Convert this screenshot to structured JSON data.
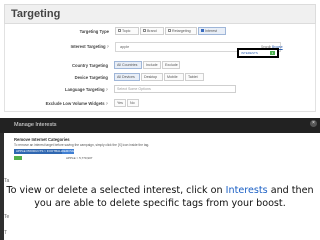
{
  "panel": {
    "title": "Targeting"
  },
  "targeting_type": {
    "label": "Targeting Type",
    "options": [
      "Topic",
      "Brand",
      "Retargeting",
      "Interest"
    ],
    "selected": "Interest"
  },
  "interest_targeting": {
    "label": "Interest Targeting",
    "input_value": "apple",
    "links": [
      "Search",
      "Browse"
    ],
    "interests_button_label": "INTERESTS",
    "selected_count": "1"
  },
  "country_targeting": {
    "label": "Country Targeting",
    "options": [
      "All Countries",
      "Include",
      "Exclude"
    ]
  },
  "device_targeting": {
    "label": "Device Targeting",
    "options": [
      "All Devices",
      "Desktop",
      "Mobile",
      "Tablet"
    ]
  },
  "language_targeting": {
    "label": "Language Targeting",
    "placeholder": "Select Some Options"
  },
  "low_volume": {
    "label": "Exclude Low Volume Widgets",
    "options": [
      "Yes",
      "No"
    ]
  },
  "modal": {
    "title": "Manage Interests",
    "subtitle": "Remove Internet Categories",
    "description": "To remove an interest target before saving the campaign, simply click the [X] icon inside the tag.",
    "tag_label": "APPLE PRODUCTS > FOOTBALL",
    "tag_button_label": "REMOVE",
    "approx_size": "APPLE > 5,770,907"
  },
  "caption": {
    "text_before": "To view or delete a selected interest, click on ",
    "highlight": "Interests",
    "text_after": " and then you are able to delete specific tags from your boost."
  },
  "background_rows": [
    "Ta",
    "Te",
    "T"
  ],
  "colors": {
    "accent_blue": "#2f67b1",
    "highlight_text": "#1a5fc4",
    "modal_bar": "#222222",
    "count_green": "#4caf50"
  },
  "icons": {
    "close": "close-icon",
    "help": "help-icon"
  }
}
